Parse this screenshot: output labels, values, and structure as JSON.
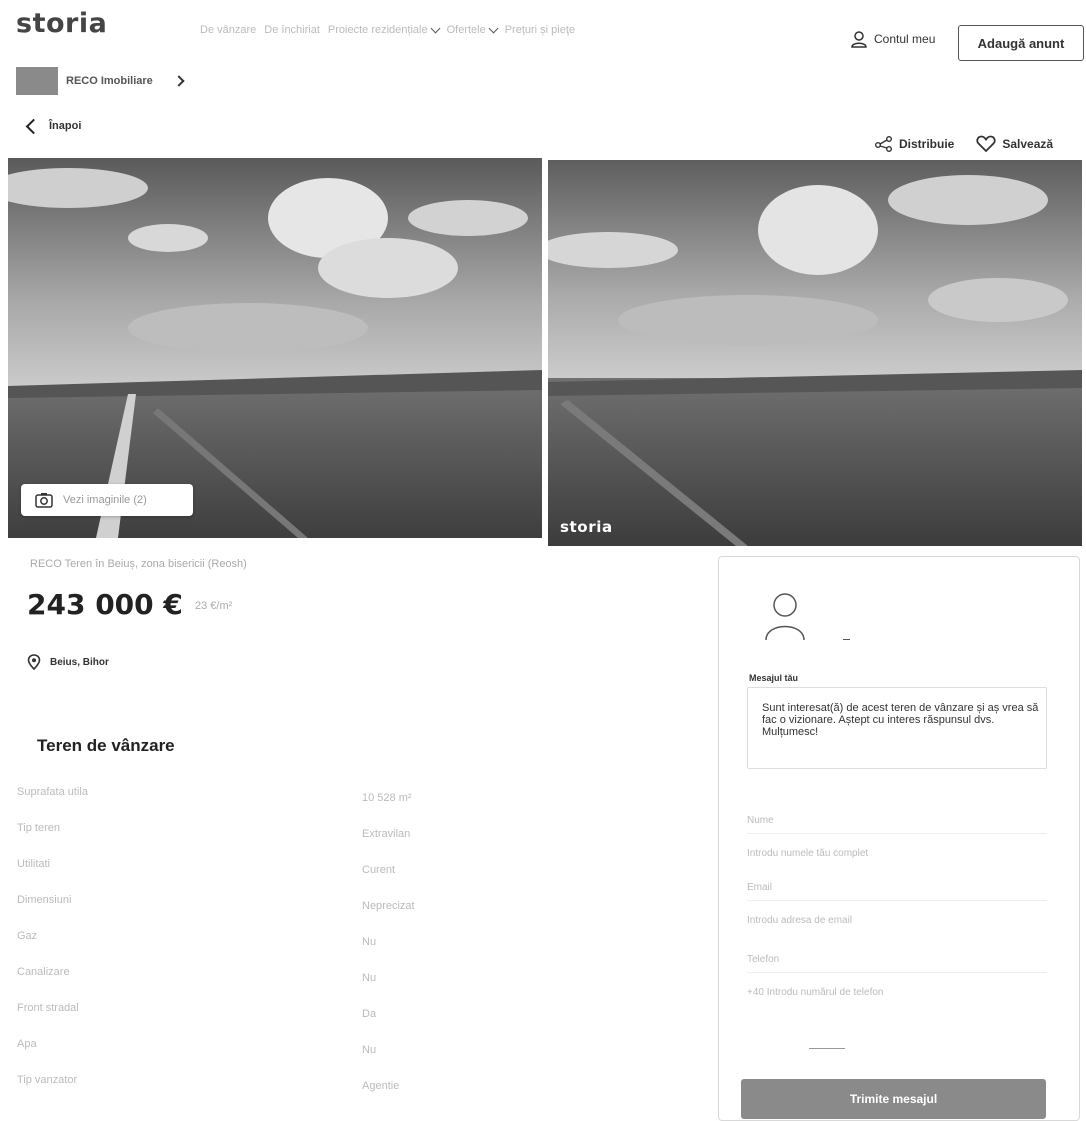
{
  "header": {
    "logo": "storia",
    "nav": [
      {
        "label": "De vânzare",
        "dropdown": false
      },
      {
        "label": "De închiriat",
        "dropdown": false
      },
      {
        "label": "Proiecte rezidențiale",
        "dropdown": true
      },
      {
        "label": "Ofertele",
        "dropdown": true
      },
      {
        "label": "Prețuri și pieţe",
        "dropdown": false
      }
    ],
    "account_label": "Contul meu",
    "add_ad_label": "Adaugă anunt"
  },
  "agency": {
    "name": "RECO Imobiliare"
  },
  "back_label": "Înapoi",
  "actions": {
    "share_label": "Distribuie",
    "save_label": "Salvează"
  },
  "gallery": {
    "see_images_label": "Vezi imaginile (2)",
    "watermark": "storia"
  },
  "listing": {
    "title": "RECO Teren în Beiuș, zona bisericii (Reosh)",
    "price": "243 000 €",
    "price_per_sqm": "23 €/m²",
    "location": "Beius, Bihor",
    "section_title": "Teren de vânzare"
  },
  "details": [
    {
      "label": "Suprafata utila",
      "value": "10 528 m²"
    },
    {
      "label": "Tip teren",
      "value": "Extravilan"
    },
    {
      "label": "Utilitati",
      "value": "Curent"
    },
    {
      "label": "Dimensiuni",
      "value": "Neprecizat"
    },
    {
      "label": "Gaz",
      "value": "Nu"
    },
    {
      "label": "Canalizare",
      "value": "Nu"
    },
    {
      "label": "Front stradal",
      "value": "Da"
    },
    {
      "label": "Apa",
      "value": "Nu"
    },
    {
      "label": "Tip vanzator",
      "value": "Agentie"
    }
  ],
  "contact": {
    "message_label": "Mesajul tău",
    "message": "Sunt interesat(ă) de acest teren de vânzare și aș vrea să fac o vizionare. Aștept cu interes răspunsul dvs. Mulțumesc!",
    "name_label": "Nume",
    "name_placeholder": "Introdu numele tău complet",
    "email_label": "Email",
    "email_placeholder": "Introdu adresa de email",
    "phone_label": "Telefon",
    "phone_placeholder": "+40 Introdu numărul de telefon",
    "send_label": "Trimite mesajul"
  }
}
